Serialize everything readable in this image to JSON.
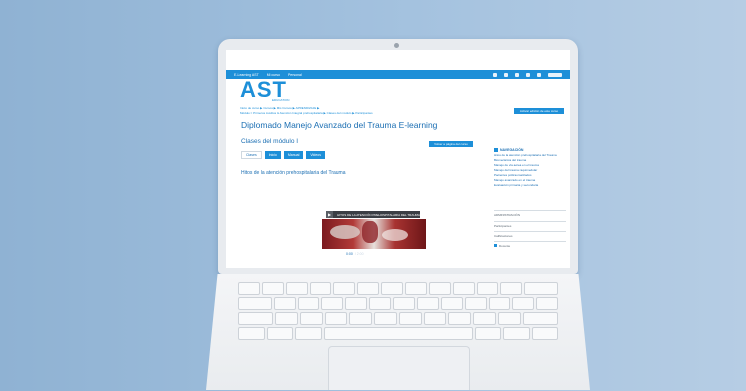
{
  "topbar": {
    "site_label": "E-Learning AST",
    "menu1": "Mi curso",
    "menu2": "Personal"
  },
  "logo": {
    "text": "AST",
    "subtitle": "EDUCATION"
  },
  "breadcrumb": {
    "line1": "Inicio de curso ▶ Cursos ▶ Mis Cursos ▶ APRENDIZAJE ▶",
    "line2": "Módulo I: Primeros Auxilios & Atención Integral prehospitalaria ▶ Clases del módulo ▶ Participantes"
  },
  "edit_button": "Activar edición de este curso",
  "course_title": "Diplomado Manejo Avanzado del Trauma E-learning",
  "section": {
    "title": "Clases del módulo I",
    "button": "Volver a página del curso",
    "tabs": [
      "Clases",
      "Inicio",
      "Manual",
      "Videos"
    ]
  },
  "page_heading": "Hitos de la atención prehospitalaria del Trauma",
  "video": {
    "bar_text": "HITOS DE LA ATENCIÓN PREHOSPITALARIA DEL TRAUMA",
    "caption_main": "0:00",
    "caption_rest": "/ 2:00"
  },
  "sidebar": {
    "heading": "NAVEGACIÓN",
    "links": [
      "Hitos de la atención prehospitalaria del Trauma",
      "Biomecánica del trauma",
      "Manejo de vía aérea en el trauma",
      "Manejo del trauma raquimedular",
      "Pacientes politraumatizados",
      "Manejo avanzado en el trauma",
      "Evaluación primaria y secundaria"
    ],
    "block1": "ADMINISTRACIÓN",
    "block2": "Participantes",
    "block3": "Calificaciones",
    "block4": "Docente"
  }
}
